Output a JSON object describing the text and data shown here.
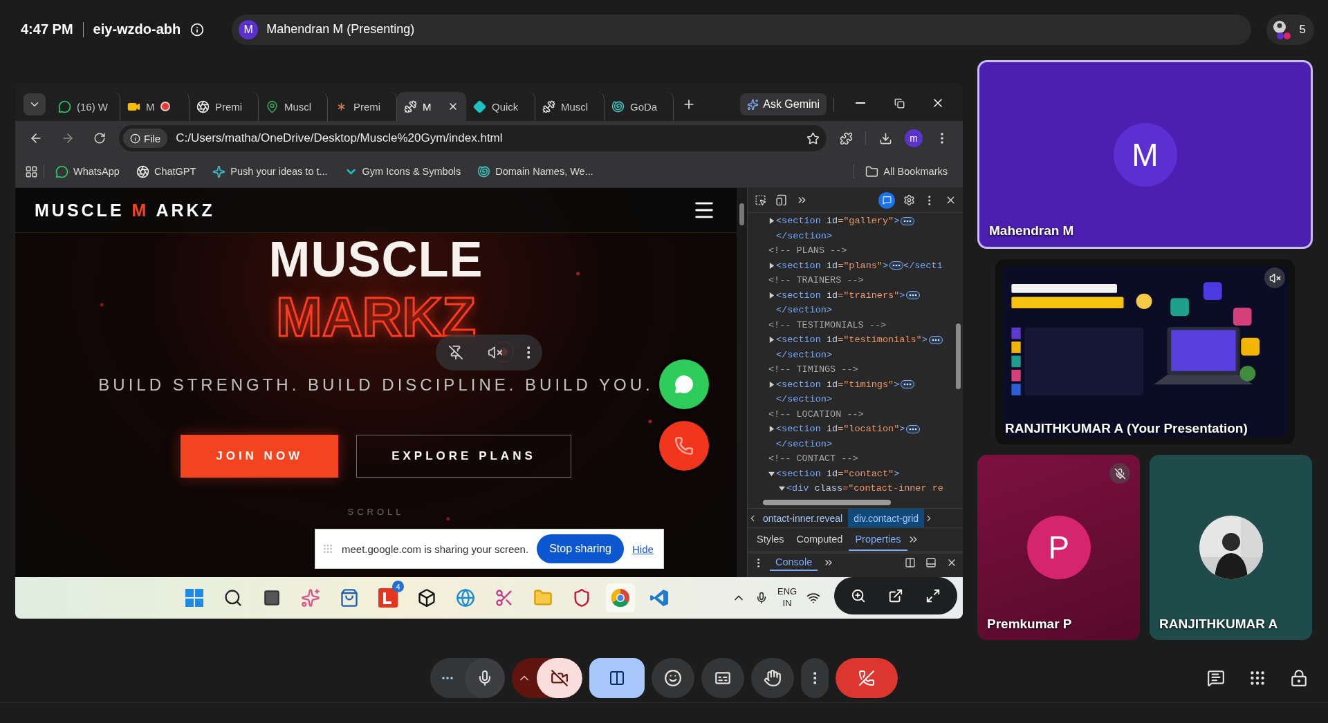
{
  "meeting": {
    "time": "4:47 PM",
    "code": "eiy-wzdo-abh"
  },
  "presenter": {
    "initial": "M",
    "label": "Mahendran M (Presenting)"
  },
  "participants": {
    "count": "5"
  },
  "browser": {
    "tabs": [
      {
        "kind": "chat",
        "label": "(16) W",
        "selected": false,
        "recording": false
      },
      {
        "kind": "camera",
        "label": "M",
        "selected": false,
        "recording": true
      },
      {
        "kind": "aperture",
        "label": "Premi",
        "selected": false,
        "recording": false
      },
      {
        "kind": "pin",
        "label": "Muscl",
        "selected": false,
        "recording": false
      },
      {
        "kind": "asterisk",
        "label": "Premi",
        "selected": false,
        "recording": false
      },
      {
        "kind": "dumbbell",
        "label": "M",
        "selected": true,
        "recording": false
      },
      {
        "kind": "diamond",
        "label": "Quick",
        "selected": false,
        "recording": false
      },
      {
        "kind": "dumbbell",
        "label": "Muscl",
        "selected": false,
        "recording": false
      },
      {
        "kind": "shell",
        "label": "GoDa",
        "selected": false,
        "recording": false
      }
    ],
    "gemini": "Ask Gemini",
    "address": {
      "scheme": "File",
      "url": "C:/Users/matha/OneDrive/Desktop/Muscle%20Gym/index.html"
    },
    "profile": "m",
    "bookmarks": [
      {
        "kind": "chat",
        "label": "WhatsApp"
      },
      {
        "kind": "aperture",
        "label": "ChatGPT"
      },
      {
        "kind": "sparkle",
        "label": "Push your ideas to t..."
      },
      {
        "kind": "vee",
        "label": "Gym Icons & Symbols"
      },
      {
        "kind": "shell",
        "label": "Domain Names, We..."
      }
    ],
    "all_bookmarks": "All Bookmarks"
  },
  "website": {
    "logo": {
      "left": "MUSCLE",
      "accent": "M",
      "right": "ARKZ"
    },
    "title": "MUSCLE",
    "title_accent": "MARKZ",
    "tagline": "BUILD STRENGTH. BUILD DISCIPLINE. BUILD YOU.",
    "buttons": [
      {
        "kind": "primary",
        "label": "JOIN NOW"
      },
      {
        "kind": "outline",
        "label": "EXPLORE PLANS"
      }
    ],
    "scroll_hint": "SCROLL"
  },
  "share_notice": {
    "message": "meet.google.com is sharing your screen.",
    "stop": "Stop sharing",
    "hide": "Hide"
  },
  "devtools": {
    "lines": [
      {
        "kind": "node",
        "expanded": false,
        "parts": [
          {
            "kind": "tag",
            "text": "<section "
          },
          {
            "kind": "attr",
            "text": "id"
          },
          {
            "kind": "value",
            "text": "=\"gallery\""
          },
          {
            "kind": "tag",
            "text": ">"
          }
        ]
      },
      {
        "kind": "close",
        "parts": [
          {
            "kind": "tag",
            "text": "</section>"
          }
        ]
      },
      {
        "kind": "comment",
        "parts": [
          {
            "kind": "comment",
            "text": "<!-- PLANS -->"
          }
        ]
      },
      {
        "kind": "node",
        "expanded": false,
        "parts": [
          {
            "kind": "tag",
            "text": "<section "
          },
          {
            "kind": "attr",
            "text": "id"
          },
          {
            "kind": "value",
            "text": "=\"plans\""
          },
          {
            "kind": "tag",
            "text": ">"
          }
        ],
        "tail": "</secti"
      },
      {
        "kind": "comment",
        "parts": [
          {
            "kind": "comment",
            "text": "<!-- TRAINERS -->"
          }
        ]
      },
      {
        "kind": "node",
        "expanded": false,
        "parts": [
          {
            "kind": "tag",
            "text": "<section "
          },
          {
            "kind": "attr",
            "text": "id"
          },
          {
            "kind": "value",
            "text": "=\"trainers\""
          },
          {
            "kind": "tag",
            "text": ">"
          }
        ]
      },
      {
        "kind": "close",
        "parts": [
          {
            "kind": "tag",
            "text": "</section>"
          }
        ]
      },
      {
        "kind": "comment",
        "parts": [
          {
            "kind": "comment",
            "text": "<!-- TESTIMONIALS -->"
          }
        ]
      },
      {
        "kind": "node",
        "expanded": false,
        "parts": [
          {
            "kind": "tag",
            "text": "<section "
          },
          {
            "kind": "attr",
            "text": "id"
          },
          {
            "kind": "value",
            "text": "=\"testimonials\""
          },
          {
            "kind": "tag",
            "text": ">"
          }
        ]
      },
      {
        "kind": "close",
        "parts": [
          {
            "kind": "tag",
            "text": "</section>"
          }
        ]
      },
      {
        "kind": "comment",
        "parts": [
          {
            "kind": "comment",
            "text": "<!-- TIMINGS -->"
          }
        ]
      },
      {
        "kind": "node",
        "expanded": false,
        "parts": [
          {
            "kind": "tag",
            "text": "<section "
          },
          {
            "kind": "attr",
            "text": "id"
          },
          {
            "kind": "value",
            "text": "=\"timings\""
          },
          {
            "kind": "tag",
            "text": ">"
          }
        ]
      },
      {
        "kind": "close",
        "parts": [
          {
            "kind": "tag",
            "text": "</section>"
          }
        ]
      },
      {
        "kind": "comment",
        "parts": [
          {
            "kind": "comment",
            "text": "<!-- LOCATION -->"
          }
        ]
      },
      {
        "kind": "node",
        "expanded": false,
        "parts": [
          {
            "kind": "tag",
            "text": "<section "
          },
          {
            "kind": "attr",
            "text": "id"
          },
          {
            "kind": "value",
            "text": "=\"location\""
          },
          {
            "kind": "tag",
            "text": ">"
          }
        ]
      },
      {
        "kind": "close",
        "parts": [
          {
            "kind": "tag",
            "text": "</section>"
          }
        ]
      },
      {
        "kind": "comment",
        "parts": [
          {
            "kind": "comment",
            "text": "<!-- CONTACT -->"
          }
        ]
      },
      {
        "kind": "node",
        "expanded": true,
        "parts": [
          {
            "kind": "tag",
            "text": "<section "
          },
          {
            "kind": "attr",
            "text": "id"
          },
          {
            "kind": "value",
            "text": "=\"contact\""
          },
          {
            "kind": "tag",
            "text": ">"
          }
        ],
        "children": [
          {
            "kind": "node",
            "expanded": true,
            "parts": [
              {
                "kind": "tag",
                "text": "<div "
              },
              {
                "kind": "attr",
                "text": "class"
              },
              {
                "kind": "value",
                "text": "=\"contact-inner re"
              }
            ]
          }
        ]
      }
    ],
    "breadcrumbs": [
      {
        "label": "ontact-inner.reveal",
        "selected": false
      },
      {
        "label": "div.contact-grid",
        "selected": true
      }
    ],
    "tabs": [
      {
        "label": "Styles",
        "selected": false
      },
      {
        "label": "Computed",
        "selected": false
      },
      {
        "label": "Properties",
        "selected": true
      }
    ],
    "drawer_tab": "Console"
  },
  "taskbar": {
    "badge": "4",
    "language": "ENG",
    "region": "IN"
  },
  "tiles": [
    {
      "kind": "avatar",
      "name": "Mahendran M",
      "initial": "M",
      "color": "#5b2fd0",
      "muted": false,
      "highlighted": true
    },
    {
      "kind": "presentation",
      "name": "RANJITHKUMAR A (Your Presentation)",
      "muted": true,
      "highlighted": false
    },
    {
      "kind": "avatar",
      "name": "Premkumar P",
      "initial": "P",
      "color": "#d6246e",
      "muted": true,
      "highlighted": false
    },
    {
      "name": "RANJITHKUMAR A",
      "muted": false,
      "highlighted": false
    }
  ],
  "controls": {
    "mic_on": true,
    "camera_on": false,
    "presenting": true
  }
}
